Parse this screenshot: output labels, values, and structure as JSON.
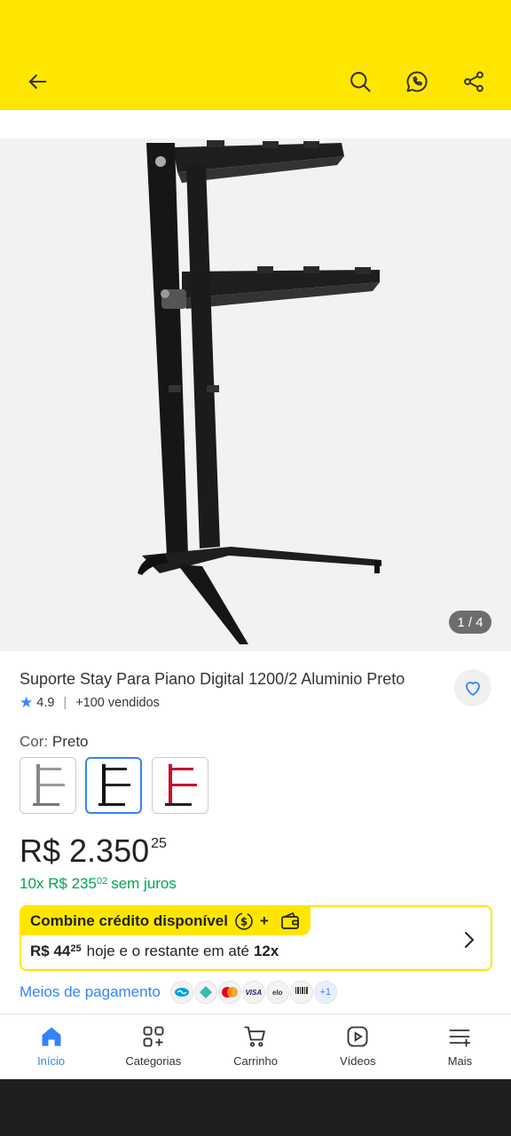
{
  "header": {
    "background": "#FFE600",
    "icons": [
      "back-arrow-icon",
      "search-icon",
      "whatsapp-icon",
      "share-icon"
    ]
  },
  "gallery": {
    "pager": "1 / 4"
  },
  "product": {
    "title": "Suporte Stay Para Piano Digital 1200/2 Aluminio Preto",
    "rating": "4.9",
    "sold": "+100 vendidos",
    "color_label": "Cor:",
    "color_value": "Preto",
    "swatches": [
      "silver",
      "black",
      "red"
    ],
    "selected_swatch": 1
  },
  "price": {
    "main": "R$ 2.350",
    "cents": "25",
    "installments_prefix": "10x R$ 235",
    "installments_cents": "02",
    "installments_suffix": "sem juros"
  },
  "credit": {
    "title": "Combine crédito disponível",
    "plus": "+",
    "amount": "R$ 44",
    "amount_cents": "25",
    "rest_text": "hoje e o restante em até",
    "rest_bold": "12x"
  },
  "payment": {
    "link": "Meios de pagamento",
    "badges": [
      "Mercado Pago",
      "Pix",
      "Mastercard",
      "VISA",
      "elo",
      "Boleto"
    ],
    "more": "+1"
  },
  "tabs": [
    {
      "label": "Início",
      "icon": "home-icon",
      "active": true
    },
    {
      "label": "Categorias",
      "icon": "categories-icon",
      "active": false
    },
    {
      "label": "Carrinho",
      "icon": "cart-icon",
      "active": false
    },
    {
      "label": "Vídeos",
      "icon": "video-icon",
      "active": false
    },
    {
      "label": "Mais",
      "icon": "menu-plus-icon",
      "active": false
    }
  ],
  "colors": {
    "accent": "#3483FA",
    "green": "#00A650",
    "yellow": "#FFE600"
  }
}
